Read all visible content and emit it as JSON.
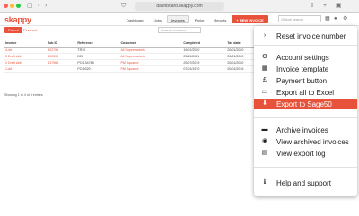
{
  "browser": {
    "address": "dashboard.skappy.com"
  },
  "app": {
    "logo": "skappy",
    "nav": [
      "Dashboard",
      "Jobs",
      "Invoices",
      "Parlor",
      "Reports"
    ],
    "new_invoice_label": "+ NEW INVOICE",
    "search_placeholder": "Global search"
  },
  "invoices": {
    "tabs": [
      "Parent",
      "Finished"
    ],
    "search_placeholder": "Search invoices",
    "columns": [
      "Invoice",
      "Job ID",
      "Reference",
      "Customer",
      "Completed",
      "Tax date"
    ],
    "rows": [
      [
        "4-##",
        "302791",
        "TR10",
        "All Supermarkets",
        "19/01/2020",
        "20/01/2020"
      ],
      [
        "3 Draft ###",
        "300509",
        "DEI",
        "All Supermarkets",
        "03/11/2021",
        "20/01/2020"
      ],
      [
        "2 Draft ###",
        "317966",
        "PO 134788",
        "PM Squared",
        "29/07/2019",
        "20/01/2020"
      ],
      [
        "1-##",
        "-",
        "PO 5320",
        "PM Squared",
        "07/01/1970",
        "20/01/2016"
      ]
    ],
    "row_count": "Showing 1 to 4 of 4 entries"
  },
  "menu": {
    "items": [
      {
        "label": "Reset invoice number",
        "icon": "chevron-right-icon",
        "glyph": "›"
      },
      {
        "label": "Account settings",
        "icon": "gear-icon",
        "glyph": "⚙"
      },
      {
        "label": "Invoice template",
        "icon": "table-icon",
        "glyph": "▦"
      },
      {
        "label": "Payment button",
        "icon": "pound-icon",
        "glyph": "£"
      },
      {
        "label": "Export all to Excel",
        "icon": "file-icon",
        "glyph": "▭"
      },
      {
        "label": "Export to Sage50",
        "icon": "download-icon",
        "glyph": "⬇",
        "highlighted": true
      },
      {
        "label": "Archive invoices",
        "icon": "archive-icon",
        "glyph": "▬"
      },
      {
        "label": "View archived invoices",
        "icon": "eye-icon",
        "glyph": "◉"
      },
      {
        "label": "View export log",
        "icon": "document-icon",
        "glyph": "▤"
      },
      {
        "label": "Help and support",
        "icon": "info-icon",
        "glyph": "ℹ"
      }
    ],
    "highlight_color": "#e8523a"
  },
  "colors": {
    "accent": "#e8523a"
  }
}
